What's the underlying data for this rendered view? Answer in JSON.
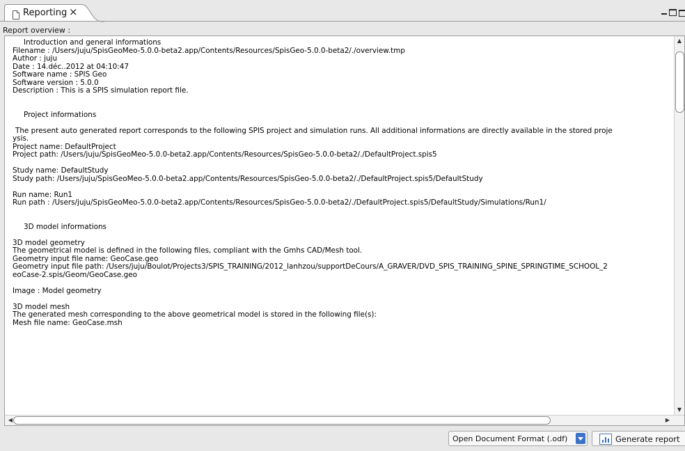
{
  "tab": {
    "title": "Reporting",
    "close_glyph": "×",
    "icon": "document-icon"
  },
  "window_controls": {
    "minimize": "minimize-icon",
    "maximize": "maximize-icon",
    "restore": "restore-icon"
  },
  "overview_label": "Report overview :",
  "report": {
    "intro_heading": "Introduction and general informations",
    "filename": "Filename : /Users/juju/SpisGeoMeo-5.0.0-beta2.app/Contents/Resources/SpisGeo-5.0.0-beta2/./overview.tmp",
    "author": "Author : juju",
    "date": "Date : 14.déc..2012 at 04:10:47",
    "software_name": "Software name : SPIS Geo",
    "software_version": "Software version : 5.0.0",
    "description": "Description : This is a SPIS simulation report file.",
    "project_heading": "Project informations",
    "project_intro_1": "The present auto generated report corresponds to the following SPIS project and simulation runs. All additional informations are directly available in the stored proje",
    "project_intro_2": "ysis.",
    "project_name": "Project name:  DefaultProject",
    "project_path": "Project path:  /Users/juju/SpisGeoMeo-5.0.0-beta2.app/Contents/Resources/SpisGeo-5.0.0-beta2/./DefaultProject.spis5",
    "study_name": "Study name:  DefaultStudy",
    "study_path": "Study path:  /Users/juju/SpisGeoMeo-5.0.0-beta2.app/Contents/Resources/SpisGeo-5.0.0-beta2/./DefaultProject.spis5/DefaultStudy",
    "run_name": "Run name:  Run1",
    "run_path": "Run path :  /Users/juju/SpisGeoMeo-5.0.0-beta2.app/Contents/Resources/SpisGeo-5.0.0-beta2/./DefaultProject.spis5/DefaultStudy/Simulations/Run1/",
    "model_heading": "3D model informations",
    "geometry_title": "3D model geometry",
    "geometry_desc": "The geometrical model is defined in the following files, compliant with the Gmhs CAD/Mesh tool.",
    "geometry_file_name": "Geometry input file name: GeoCase.geo",
    "geometry_file_path_1": "Geometry input file path: /Users/juju/Boulot/Projects3/SPIS_TRAINING/2012_lanhzou/supportDeCours/A_GRAVER/DVD_SPIS_TRAINING_SPINE_SPRINGTIME_SCHOOL_2",
    "geometry_file_path_2": "eoCase-2.spis/Geom/GeoCase.geo",
    "image_geometry": "Image : Model geometry",
    "mesh_title": "3D model mesh",
    "mesh_desc": "The generated mesh corresponding to the above geometrical model is stored in the following file(s):",
    "mesh_file_name": "Mesh file name: GeoCase.msh"
  },
  "bottom": {
    "format_value": "Open Document Format (.odf)",
    "generate_label": "Generate report"
  }
}
